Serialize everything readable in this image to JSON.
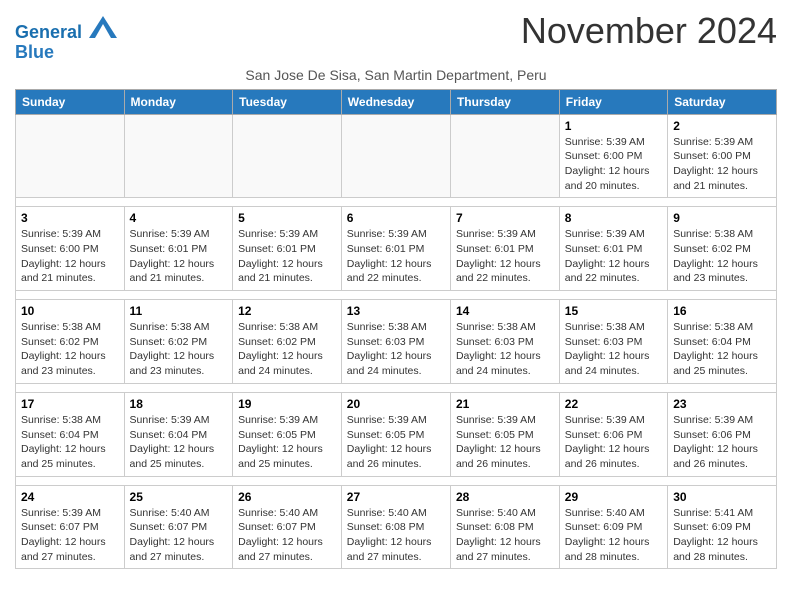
{
  "header": {
    "logo_line1": "General",
    "logo_line2": "Blue",
    "month_title": "November 2024",
    "subtitle": "San Jose De Sisa, San Martin Department, Peru"
  },
  "weekdays": [
    "Sunday",
    "Monday",
    "Tuesday",
    "Wednesday",
    "Thursday",
    "Friday",
    "Saturday"
  ],
  "weeks": [
    [
      {
        "day": "",
        "info": ""
      },
      {
        "day": "",
        "info": ""
      },
      {
        "day": "",
        "info": ""
      },
      {
        "day": "",
        "info": ""
      },
      {
        "day": "",
        "info": ""
      },
      {
        "day": "1",
        "info": "Sunrise: 5:39 AM\nSunset: 6:00 PM\nDaylight: 12 hours\nand 20 minutes."
      },
      {
        "day": "2",
        "info": "Sunrise: 5:39 AM\nSunset: 6:00 PM\nDaylight: 12 hours\nand 21 minutes."
      }
    ],
    [
      {
        "day": "3",
        "info": "Sunrise: 5:39 AM\nSunset: 6:00 PM\nDaylight: 12 hours\nand 21 minutes."
      },
      {
        "day": "4",
        "info": "Sunrise: 5:39 AM\nSunset: 6:01 PM\nDaylight: 12 hours\nand 21 minutes."
      },
      {
        "day": "5",
        "info": "Sunrise: 5:39 AM\nSunset: 6:01 PM\nDaylight: 12 hours\nand 21 minutes."
      },
      {
        "day": "6",
        "info": "Sunrise: 5:39 AM\nSunset: 6:01 PM\nDaylight: 12 hours\nand 22 minutes."
      },
      {
        "day": "7",
        "info": "Sunrise: 5:39 AM\nSunset: 6:01 PM\nDaylight: 12 hours\nand 22 minutes."
      },
      {
        "day": "8",
        "info": "Sunrise: 5:39 AM\nSunset: 6:01 PM\nDaylight: 12 hours\nand 22 minutes."
      },
      {
        "day": "9",
        "info": "Sunrise: 5:38 AM\nSunset: 6:02 PM\nDaylight: 12 hours\nand 23 minutes."
      }
    ],
    [
      {
        "day": "10",
        "info": "Sunrise: 5:38 AM\nSunset: 6:02 PM\nDaylight: 12 hours\nand 23 minutes."
      },
      {
        "day": "11",
        "info": "Sunrise: 5:38 AM\nSunset: 6:02 PM\nDaylight: 12 hours\nand 23 minutes."
      },
      {
        "day": "12",
        "info": "Sunrise: 5:38 AM\nSunset: 6:02 PM\nDaylight: 12 hours\nand 24 minutes."
      },
      {
        "day": "13",
        "info": "Sunrise: 5:38 AM\nSunset: 6:03 PM\nDaylight: 12 hours\nand 24 minutes."
      },
      {
        "day": "14",
        "info": "Sunrise: 5:38 AM\nSunset: 6:03 PM\nDaylight: 12 hours\nand 24 minutes."
      },
      {
        "day": "15",
        "info": "Sunrise: 5:38 AM\nSunset: 6:03 PM\nDaylight: 12 hours\nand 24 minutes."
      },
      {
        "day": "16",
        "info": "Sunrise: 5:38 AM\nSunset: 6:04 PM\nDaylight: 12 hours\nand 25 minutes."
      }
    ],
    [
      {
        "day": "17",
        "info": "Sunrise: 5:38 AM\nSunset: 6:04 PM\nDaylight: 12 hours\nand 25 minutes."
      },
      {
        "day": "18",
        "info": "Sunrise: 5:39 AM\nSunset: 6:04 PM\nDaylight: 12 hours\nand 25 minutes."
      },
      {
        "day": "19",
        "info": "Sunrise: 5:39 AM\nSunset: 6:05 PM\nDaylight: 12 hours\nand 25 minutes."
      },
      {
        "day": "20",
        "info": "Sunrise: 5:39 AM\nSunset: 6:05 PM\nDaylight: 12 hours\nand 26 minutes."
      },
      {
        "day": "21",
        "info": "Sunrise: 5:39 AM\nSunset: 6:05 PM\nDaylight: 12 hours\nand 26 minutes."
      },
      {
        "day": "22",
        "info": "Sunrise: 5:39 AM\nSunset: 6:06 PM\nDaylight: 12 hours\nand 26 minutes."
      },
      {
        "day": "23",
        "info": "Sunrise: 5:39 AM\nSunset: 6:06 PM\nDaylight: 12 hours\nand 26 minutes."
      }
    ],
    [
      {
        "day": "24",
        "info": "Sunrise: 5:39 AM\nSunset: 6:07 PM\nDaylight: 12 hours\nand 27 minutes."
      },
      {
        "day": "25",
        "info": "Sunrise: 5:40 AM\nSunset: 6:07 PM\nDaylight: 12 hours\nand 27 minutes."
      },
      {
        "day": "26",
        "info": "Sunrise: 5:40 AM\nSunset: 6:07 PM\nDaylight: 12 hours\nand 27 minutes."
      },
      {
        "day": "27",
        "info": "Sunrise: 5:40 AM\nSunset: 6:08 PM\nDaylight: 12 hours\nand 27 minutes."
      },
      {
        "day": "28",
        "info": "Sunrise: 5:40 AM\nSunset: 6:08 PM\nDaylight: 12 hours\nand 27 minutes."
      },
      {
        "day": "29",
        "info": "Sunrise: 5:40 AM\nSunset: 6:09 PM\nDaylight: 12 hours\nand 28 minutes."
      },
      {
        "day": "30",
        "info": "Sunrise: 5:41 AM\nSunset: 6:09 PM\nDaylight: 12 hours\nand 28 minutes."
      }
    ]
  ]
}
